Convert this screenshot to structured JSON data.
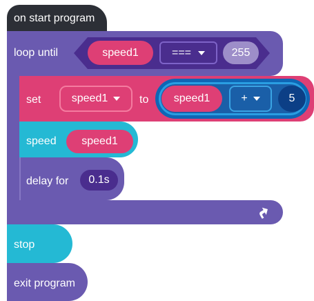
{
  "hat": {
    "label": "on start program"
  },
  "loop": {
    "label": "loop until",
    "condition": {
      "variable": "speed1",
      "operator": "===",
      "value": "255"
    }
  },
  "set": {
    "label": "set",
    "variable": "speed1",
    "to_label": "to",
    "expression": {
      "variable": "speed1",
      "operator": "+",
      "value": "5"
    }
  },
  "speed": {
    "label": "speed",
    "variable": "speed1"
  },
  "delay": {
    "label": "delay for",
    "value": "0.1s"
  },
  "stop": {
    "label": "stop"
  },
  "exit": {
    "label": "exit program"
  },
  "icons": {
    "repeat": "repeat-arrow-icon",
    "dropdown": "caret-down-icon"
  },
  "colors": {
    "hat": "#2c2f36",
    "control": "#6a5ab0",
    "variable": "#de3f75",
    "math": "#1a5fa8",
    "motor": "#24b9d4"
  }
}
